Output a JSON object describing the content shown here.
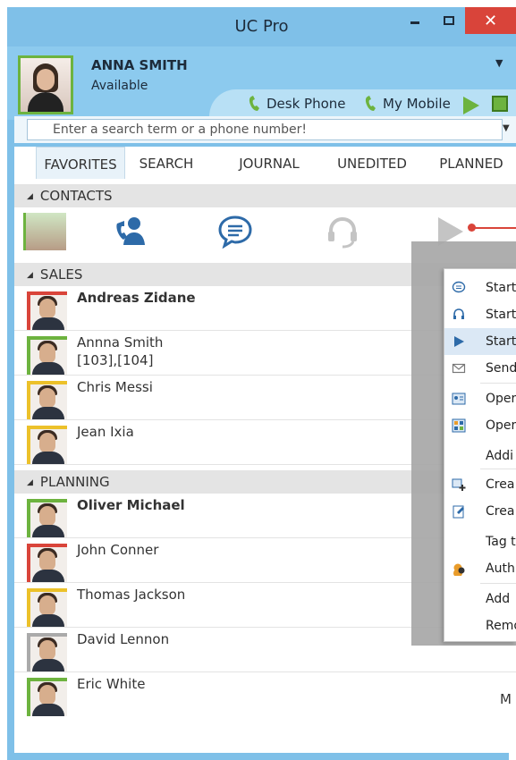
{
  "window": {
    "title": "UC Pro"
  },
  "user": {
    "name": "ANNA SMITH",
    "status": "Available"
  },
  "phones": [
    {
      "label": "Desk Phone",
      "color": "#6db33f"
    },
    {
      "label": "My Mobile",
      "color": "#6db33f"
    }
  ],
  "search": {
    "placeholder": "Enter a search term or a phone number!"
  },
  "tabs": [
    "FAVORITES",
    "SEARCH",
    "JOURNAL",
    "UNEDITED",
    "PLANNED"
  ],
  "groups": [
    {
      "label": "CONTACTS"
    },
    {
      "label": "SALES"
    },
    {
      "label": "PLANNING"
    }
  ],
  "sales": [
    {
      "name": "Andreas Zidane",
      "sub": "",
      "status": "red"
    },
    {
      "name": "Annna Smith",
      "sub": "[103],[104]",
      "status": "green"
    },
    {
      "name": "Chris Messi",
      "sub": "",
      "status": "yellow"
    },
    {
      "name": "Jean Ixia",
      "sub": "",
      "status": "yellow"
    }
  ],
  "planning": [
    {
      "name": "Oliver Michael",
      "sub": "",
      "status": "green"
    },
    {
      "name": "John Conner",
      "sub": "",
      "status": "red"
    },
    {
      "name": "Thomas Jackson",
      "sub": "",
      "status": "yellow"
    },
    {
      "name": "David Lennon",
      "sub": "",
      "status": "grey"
    },
    {
      "name": "Eric White",
      "sub": "",
      "status": "green"
    }
  ],
  "context_menu": [
    {
      "label": "Start",
      "icon": "chat-icon"
    },
    {
      "label": "Start",
      "icon": "headset-icon"
    },
    {
      "label": "Start",
      "icon": "play-icon",
      "highlighted": true
    },
    {
      "label": "Send",
      "icon": "envelope-icon"
    },
    {
      "label": "Oper",
      "icon": "contact-card-icon"
    },
    {
      "label": "Oper",
      "icon": "grid-card-icon"
    },
    {
      "label": "Addi",
      "icon": ""
    },
    {
      "label": "Crea",
      "icon": "create-contact-icon"
    },
    {
      "label": "Crea",
      "icon": "create-note-icon"
    },
    {
      "label": "Tag t",
      "icon": ""
    },
    {
      "label": "Auth",
      "icon": "authorize-icon"
    },
    {
      "label": "Add",
      "icon": ""
    },
    {
      "label": "Remo",
      "icon": ""
    }
  ],
  "bottom_text": "M",
  "colors": {
    "accent": "#7fc0e8",
    "available": "#6db33f",
    "busy": "#d9443a",
    "away": "#ecc12a"
  }
}
